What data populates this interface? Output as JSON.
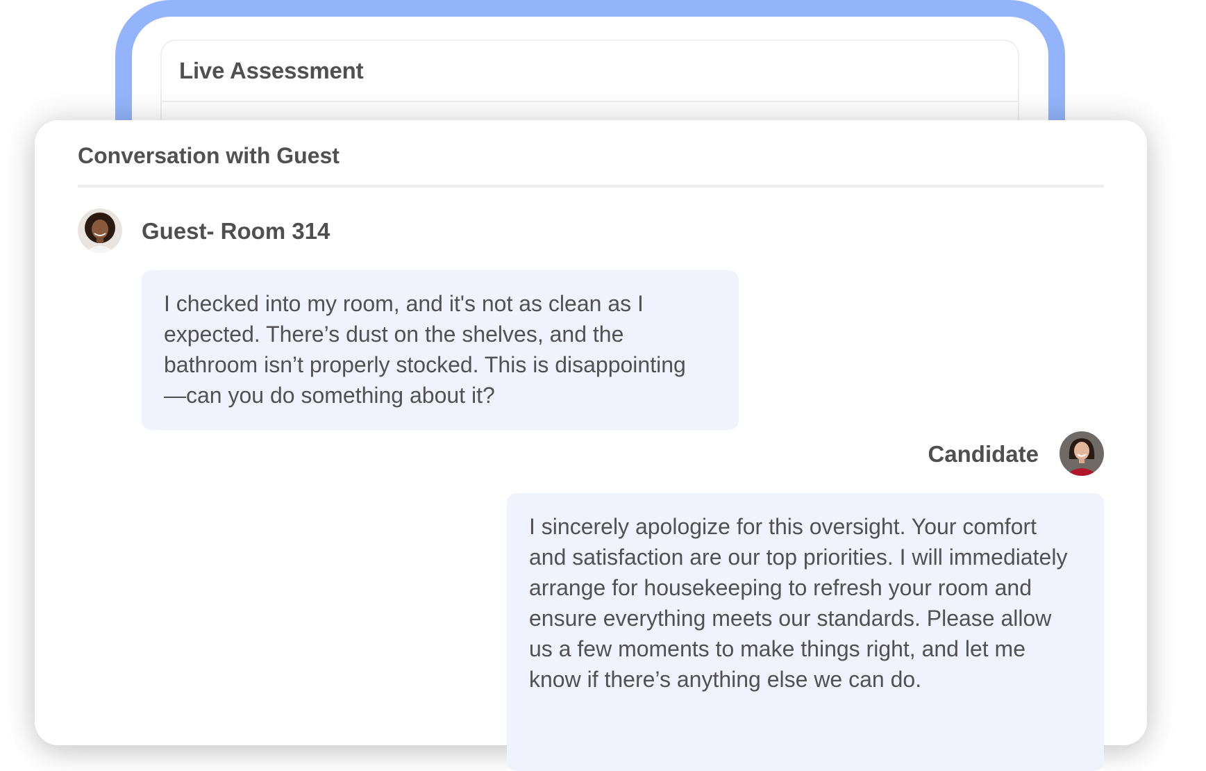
{
  "live_assessment": {
    "title": "Live Assessment"
  },
  "conversation": {
    "title": "Conversation with Guest",
    "messages": [
      {
        "speaker": "Guest- Room 314",
        "avatar_icon": "guest-avatar-photo",
        "lines": [
          "I checked into my room, and it's not as clean as I",
          "expected. There’s dust on the shelves, and the",
          "bathroom isn’t properly stocked. This is disappointing",
          "—can you do something about it?"
        ]
      },
      {
        "speaker": "Candidate",
        "avatar_icon": "candidate-avatar-photo",
        "lines": [
          "I sincerely apologize for this oversight. Your comfort",
          "and satisfaction are our top priorities. I will immediately",
          "arrange for housekeeping to refresh your room and",
          "ensure everything meets our standards. Please allow",
          "us a few moments to make things right, and let me",
          "know if there’s anything else we can do."
        ]
      }
    ]
  },
  "colors": {
    "frame_border": "#93b4fb",
    "bubble_background": "#f0f3fd",
    "text": "#505050"
  }
}
